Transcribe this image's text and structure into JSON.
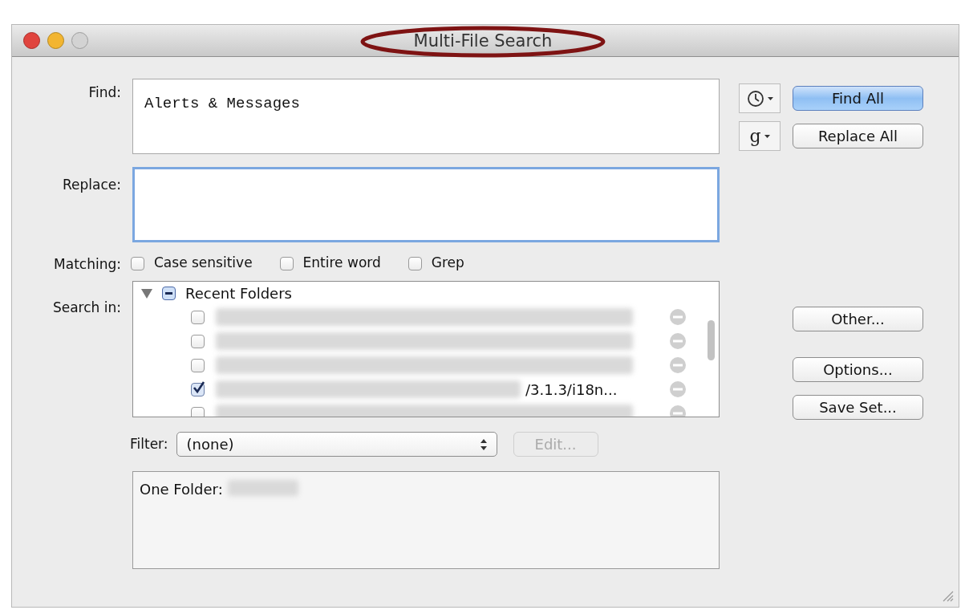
{
  "window": {
    "title": "Multi-File Search"
  },
  "find": {
    "label": "Find:",
    "value": "Alerts & Messages"
  },
  "replace": {
    "label": "Replace:",
    "focused": true
  },
  "side_menus": [
    {
      "kind": "clock"
    },
    {
      "kind": "text",
      "label": "g"
    }
  ],
  "buttons": [
    {
      "label": "Find All",
      "default": true
    },
    {
      "label": "Replace All",
      "default": false
    }
  ],
  "matching": {
    "label": "Matching:",
    "options": [
      {
        "label": "Case sensitive",
        "checked": false
      },
      {
        "label": "Entire word",
        "checked": false
      },
      {
        "label": "Grep",
        "checked": false
      }
    ]
  },
  "search_in": {
    "label": "Search in:",
    "group": {
      "label": "Recent Folders",
      "expanded": true,
      "mixed": true,
      "children": [
        {
          "checked": false
        },
        {
          "checked": false
        },
        {
          "checked": false
        },
        {
          "checked": true,
          "visible_text": "/3.1.3/i18n..."
        },
        {
          "checked": false
        }
      ]
    }
  },
  "side_buttons": [
    "Other...",
    "Options...",
    "Save Set..."
  ],
  "filter": {
    "label": "Filter:",
    "value": "(none)",
    "edit_button": {
      "label": "Edit...",
      "disabled": true
    }
  },
  "summary": {
    "label": "One Folder:"
  }
}
